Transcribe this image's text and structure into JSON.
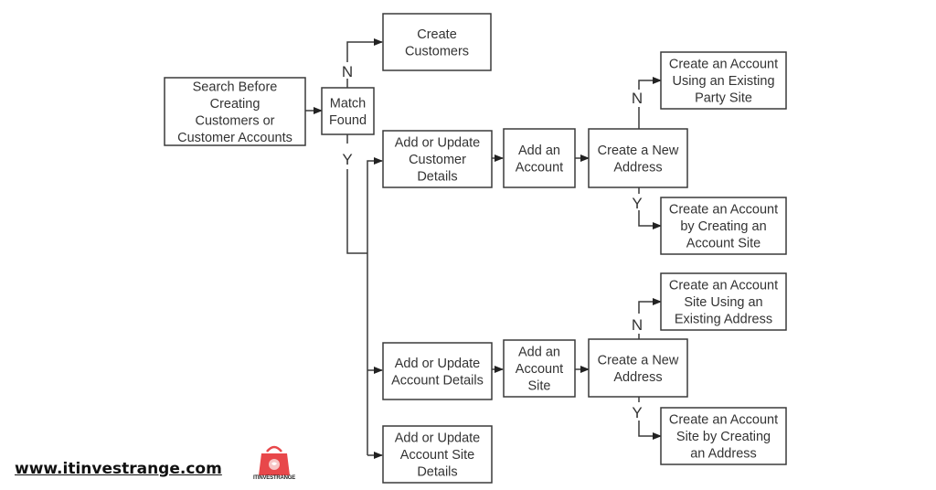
{
  "diagram": {
    "nodes": [
      {
        "id": "search",
        "lines": [
          "Search Before",
          "Creating",
          "Customers or",
          "Customer Accounts"
        ]
      },
      {
        "id": "match",
        "lines": [
          "Match",
          "Found"
        ]
      },
      {
        "id": "create_customers",
        "lines": [
          "Create",
          "Customers"
        ]
      },
      {
        "id": "update_customer",
        "lines": [
          "Add or Update",
          "Customer",
          "Details"
        ]
      },
      {
        "id": "add_account",
        "lines": [
          "Add an",
          "Account"
        ]
      },
      {
        "id": "new_address_1",
        "lines": [
          "Create a New",
          "Address"
        ]
      },
      {
        "id": "acct_existing_party",
        "lines": [
          "Create an Account",
          "Using an Existing",
          "Party Site"
        ]
      },
      {
        "id": "acct_create_site",
        "lines": [
          "Create an Account",
          "by Creating an",
          "Account Site"
        ]
      },
      {
        "id": "update_account",
        "lines": [
          "Add or Update",
          "Account Details"
        ]
      },
      {
        "id": "add_account_site",
        "lines": [
          "Add an",
          "Account",
          "Site"
        ]
      },
      {
        "id": "new_address_2",
        "lines": [
          "Create a New",
          "Address"
        ]
      },
      {
        "id": "site_existing_address",
        "lines": [
          "Create an Account",
          "Site Using an",
          "Existing Address"
        ]
      },
      {
        "id": "site_create_address",
        "lines": [
          "Create an Account",
          "Site by Creating",
          "an Address"
        ]
      },
      {
        "id": "update_account_site",
        "lines": [
          "Add or Update",
          "Account Site",
          "Details"
        ]
      }
    ],
    "edge_labels": {
      "no": "N",
      "yes": "Y"
    }
  },
  "footer": {
    "url": "www.itinvestrange.com",
    "logo_text": "ITINVESTRANGE",
    "logo_color": "#e8474a"
  }
}
